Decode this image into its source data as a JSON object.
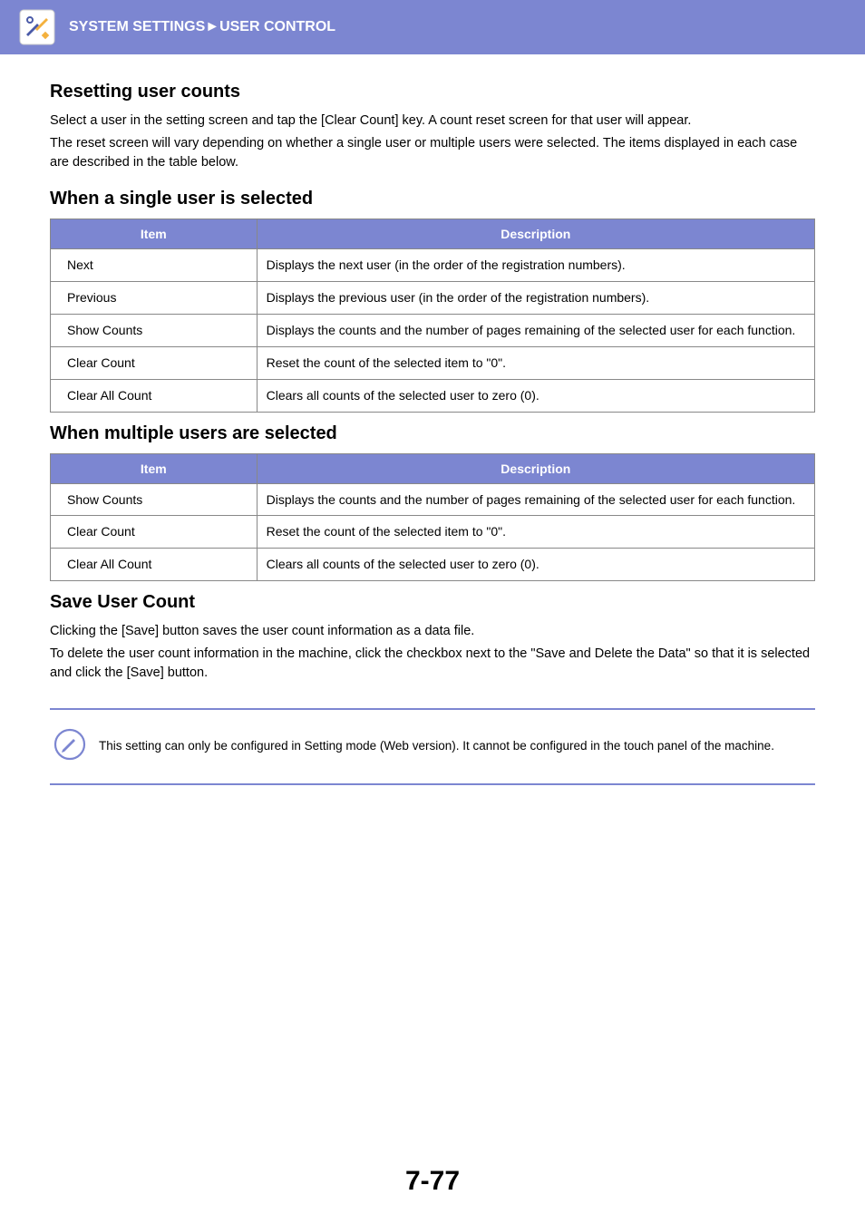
{
  "header": {
    "breadcrumb": "SYSTEM SETTINGS►USER CONTROL"
  },
  "sections": {
    "reset": {
      "title": "Resetting user counts",
      "p1": "Select a user in the setting screen and tap the [Clear Count] key. A count reset screen for that user will appear.",
      "p2": "The reset screen will vary depending on whether a single user or multiple users were selected. The items displayed in each case are described in the table below."
    },
    "single": {
      "title": "When a single user is selected",
      "col_item": "Item",
      "col_desc": "Description",
      "rows": [
        {
          "item": "Next",
          "desc": "Displays the next user (in the order of the registration numbers)."
        },
        {
          "item": "Previous",
          "desc": "Displays the previous user (in the order of the registration numbers)."
        },
        {
          "item": "Show Counts",
          "desc": "Displays the counts and the number of pages remaining of the selected user for each function."
        },
        {
          "item": "Clear Count",
          "desc": "Reset the count of the selected item to \"0\"."
        },
        {
          "item": "Clear All Count",
          "desc": "Clears all counts of the selected user to zero (0)."
        }
      ]
    },
    "multiple": {
      "title": "When multiple users are selected",
      "col_item": "Item",
      "col_desc": "Description",
      "rows": [
        {
          "item": "Show Counts",
          "desc": "Displays the counts and the number of pages remaining of the selected user for each function."
        },
        {
          "item": "Clear Count",
          "desc": "Reset the count of the selected item to \"0\"."
        },
        {
          "item": "Clear All Count",
          "desc": "Clears all counts of the selected user to zero (0)."
        }
      ]
    },
    "save": {
      "title": "Save User Count",
      "p1": "Clicking the [Save] button saves the user count information as a data file.",
      "p2": "To delete the user count information in the machine, click the checkbox next to the \"Save and Delete the Data\" so that it is selected and click the [Save] button."
    },
    "note": {
      "text": "This setting can only be configured in Setting mode (Web version). It cannot be configured in the touch panel of the machine."
    }
  },
  "page_number": "7-77"
}
